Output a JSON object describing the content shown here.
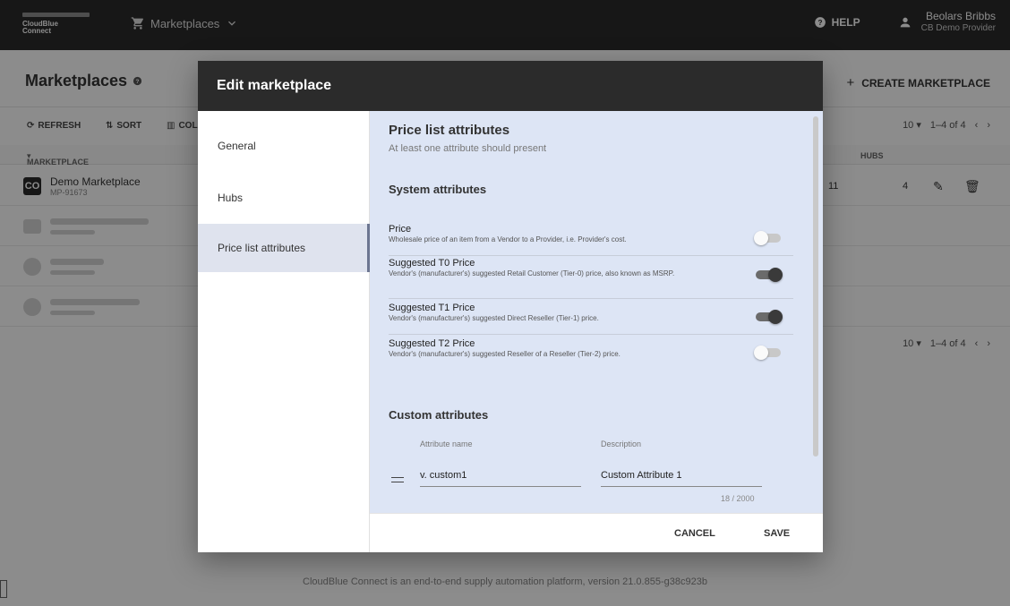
{
  "topbar": {
    "logo_line1": "CloudBlue",
    "logo_line2": "Connect",
    "nav_label": "Marketplaces",
    "help_label": "HELP",
    "user_name": "Beolars Bribbs",
    "user_role": "CB Demo Provider"
  },
  "page": {
    "title": "Marketplaces",
    "create_label": "CREATE MARKETPLACE",
    "toolbar": {
      "refresh": "REFRESH",
      "sort": "SORT",
      "columns": "COL"
    },
    "pager": {
      "per_page": "10",
      "range": "1–4 of 4"
    },
    "columns": {
      "marketplace": "MARKETPLACE",
      "hubs": "HUBS"
    },
    "rows": [
      {
        "icon": "CO",
        "name": "Demo Marketplace",
        "id": "MP-91673",
        "num1": "11",
        "num2": "4"
      }
    ],
    "footer": "CloudBlue Connect is an end-to-end supply automation platform, version 21.0.855-g38c923b"
  },
  "modal": {
    "title": "Edit marketplace",
    "side_items": [
      "General",
      "Hubs",
      "Price list attributes"
    ],
    "section_title": "Price list attributes",
    "section_sub": "At least one attribute should present",
    "system_title": "System attributes",
    "attributes": [
      {
        "name": "Price",
        "desc": "Wholesale price of an item from a Vendor to a Provider, i.e. Provider's cost.",
        "enabled": false
      },
      {
        "name": "Suggested T0 Price",
        "desc": "Vendor's (manufacturer's) suggested Retail Customer (Tier-0) price, also known as MSRP.",
        "enabled": true
      },
      {
        "name": "Suggested T1 Price",
        "desc": "Vendor's (manufacturer's) suggested Direct Reseller (Tier-1) price.",
        "enabled": true
      },
      {
        "name": "Suggested T2 Price",
        "desc": "Vendor's (manufacturer's) suggested Reseller of a Reseller (Tier-2) price.",
        "enabled": false
      }
    ],
    "custom_title": "Custom attributes",
    "custom_headers": {
      "name": "Attribute name",
      "description": "Description"
    },
    "custom_row": {
      "name": "v. custom1",
      "description": "Custom Attribute 1",
      "counter": "18 / 2000"
    },
    "cancel_label": "CANCEL",
    "save_label": "SAVE"
  },
  "colors": {
    "topbar": "#2b2b2b",
    "modal_body": "#dde5f5",
    "active_nav": "#dfe3ee"
  }
}
